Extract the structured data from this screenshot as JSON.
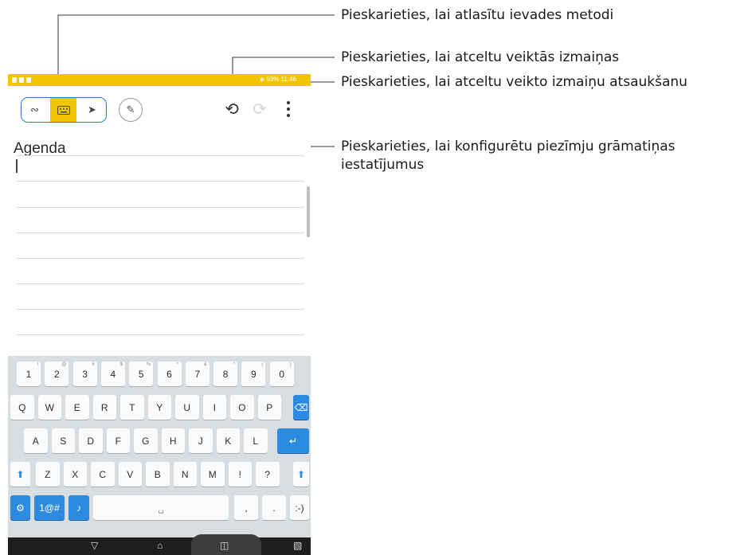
{
  "callouts": {
    "input_method": "Pieskarieties, lai atlasītu ievades metodi",
    "undo": "Pieskarieties, lai atceltu veiktās izmaiņas",
    "redo": "Pieskarieties, lai atceltu veikto izmaiņu atsaukšanu",
    "settings_line1": "Pieskarieties, lai konfigurētu piezīmju grāmatiņas",
    "settings_line2": "iestatījumus"
  },
  "statusbar": {
    "battery": "93%",
    "time": "11:46"
  },
  "toolbar": {
    "mode_handwriting_icon": "handwriting-icon",
    "mode_keyboard_icon": "keyboard-icon",
    "mode_drawing_icon": "brush-icon",
    "pen_style_icon": "pen-style-icon",
    "undo_icon": "undo-icon",
    "redo_icon": "redo-icon",
    "more_icon": "more-vertical-icon"
  },
  "note": {
    "title": "Agenda"
  },
  "keyboard": {
    "row_numbers": [
      {
        "k": "1",
        "s": "!"
      },
      {
        "k": "2",
        "s": "@"
      },
      {
        "k": "3",
        "s": "#"
      },
      {
        "k": "4",
        "s": "$"
      },
      {
        "k": "5",
        "s": "%"
      },
      {
        "k": "6",
        "s": "^"
      },
      {
        "k": "7",
        "s": "&"
      },
      {
        "k": "8",
        "s": "*"
      },
      {
        "k": "9",
        "s": "("
      },
      {
        "k": "0",
        "s": ")"
      }
    ],
    "row_q": [
      "Q",
      "W",
      "E",
      "R",
      "T",
      "Y",
      "U",
      "I",
      "O",
      "P"
    ],
    "row_a": [
      "A",
      "S",
      "D",
      "F",
      "G",
      "H",
      "J",
      "K",
      "L"
    ],
    "row_z": [
      "Z",
      "X",
      "C",
      "V",
      "B",
      "N",
      "M",
      "!",
      "?"
    ],
    "symbols_label": "1@#",
    "comma": ",",
    "period": ".",
    "smiley": ":-)"
  },
  "colors": {
    "accent": "#f5c400",
    "blue": "#2c8be0"
  }
}
